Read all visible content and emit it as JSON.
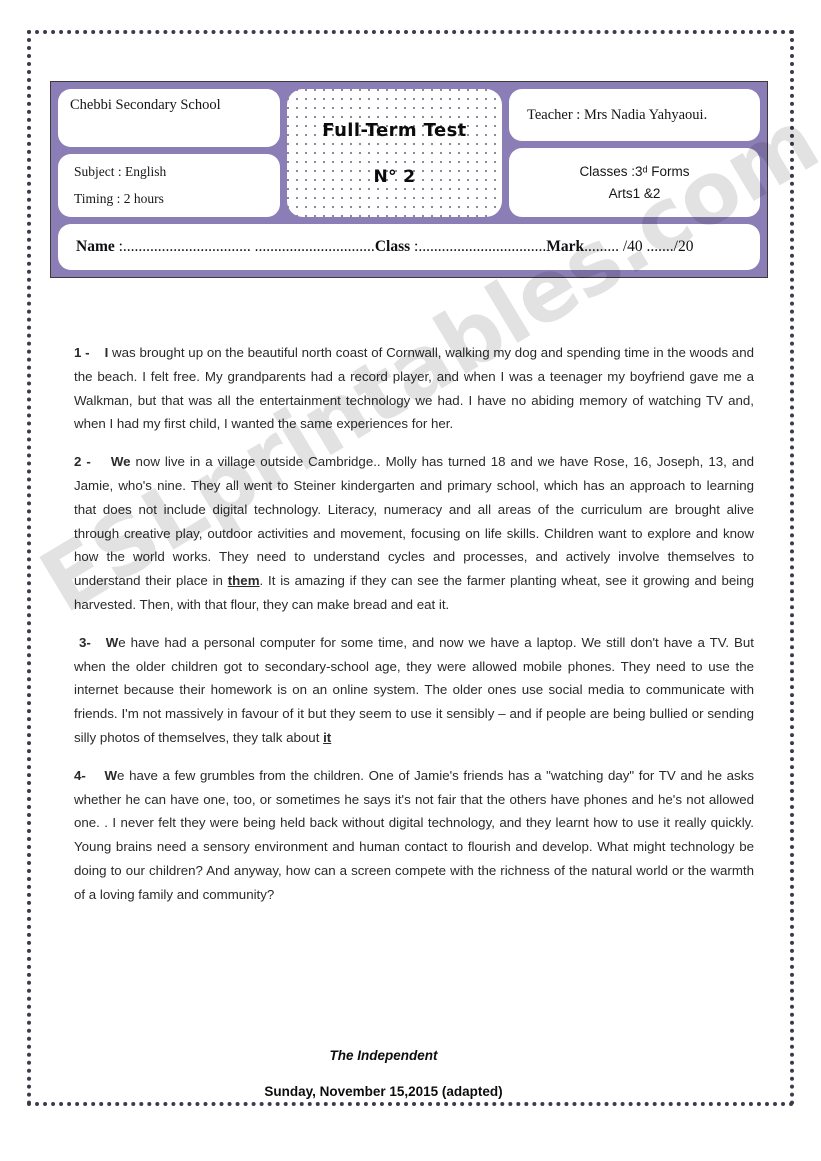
{
  "header": {
    "school": "Chebbi Secondary School",
    "subject": "Subject : English",
    "timing": "Timing : 2 hours",
    "test_title": "Full-Term Test",
    "test_number": "N° 2",
    "teacher": "Teacher :  Mrs Nadia  Yahyaoui.",
    "classes_line1": "Classes :3ᵈ Forms",
    "classes_line2": "Arts1 &2",
    "name_field_label": "Name",
    "name_dots": " :................................. ...............................",
    "class_field_label": "Class",
    "class_dots": " :.................................",
    "mark_field_label": "Mark",
    "mark_dots": "......... /40  ......./20"
  },
  "body": {
    "paragraphs": [
      {
        "number": "1 -",
        "lead": "I",
        "text": " was brought up on the beautiful north coast of Cornwall, walking my dog and spending time in the woods and the beach. I felt free. My grandparents had a record player, and when I was a teenager my boyfriend gave me a Walkman, but that was all the entertainment technology we had. I have no abiding memory of watching TV and, when I had my first child, I wanted the same experiences for her."
      },
      {
        "number": "2 -",
        "lead": "We",
        "text_before": "  now live in a village outside Cambridge.. Molly has turned 18 and we have Rose, 16, Joseph, 13, and Jamie, who's nine. They all went to Steiner kindergarten and primary school, which has an approach to learning that does not include digital technology. Literacy, numeracy and all areas of the curriculum are brought alive through creative play, outdoor activities and movement, focusing on life skills. Children want to explore and know how the world works. They need to understand cycles and processes, and actively involve themselves to understand their place in ",
        "underlined": "them",
        "text_after": ". It is amazing if they can see the farmer planting wheat, see it growing and being harvested. Then, with that flour, they can make bread and eat it."
      },
      {
        "number": "3-",
        "lead": "W",
        "text_before": "e have had a personal computer for some time, and now we have a laptop. We still don't have a TV. But when the older children got to secondary-school age, they were allowed mobile phones. They need to use the internet because their homework is on an online system. The older ones use social media to communicate with friends. I'm not massively in favour of it but they seem to use it sensibly – and if people are being bullied or sending silly photos of themselves, they talk about ",
        "underlined": "it",
        "text_after": ""
      },
      {
        "number": "4-",
        "lead": "W",
        "text": "e have a few grumbles from the children. One of Jamie's friends has a \"watching day\" for TV and he asks whether he can have one, too, or sometimes he says it's not fair that the others have phones and he's not allowed one. . I never felt they were being held back without digital technology, and they learnt how to use it really quickly. Young brains need a sensory environment and human contact to flourish and develop. What might technology be doing to our children?  And anyway, how can a screen compete with the richness of the natural world or the warmth of a loving family and community?"
      }
    ]
  },
  "footer": {
    "source": "The Independent",
    "date": "Sunday, November 15,2015 (adapted)"
  },
  "watermark": {
    "text": "ESLprintables.com"
  },
  "colors": {
    "frame_purple": "#8b7db5",
    "border_dark": "#3c3b4e",
    "cell_white": "#ffffff"
  }
}
